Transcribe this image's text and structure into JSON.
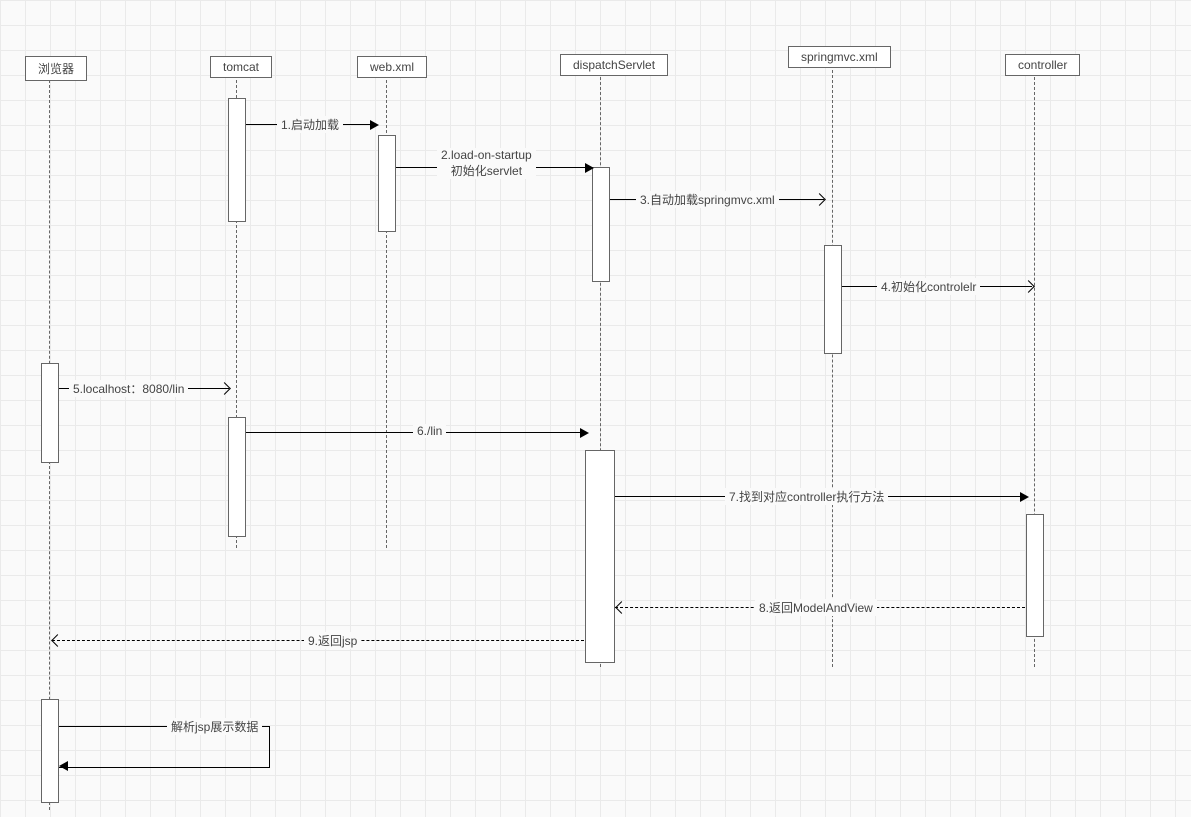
{
  "participants": {
    "browser": "浏览器",
    "tomcat": "tomcat",
    "webxml": "web.xml",
    "dispatch": "dispatchServlet",
    "springmvc": "springmvc.xml",
    "controller": "controller"
  },
  "messages": {
    "m1": "1.启动加载",
    "m2a": "2.load-on-startup",
    "m2b": "初始化servlet",
    "m3": "3.自动加载springmvc.xml",
    "m4": "4.初始化controlelr",
    "m5": "5.localhost：8080/lin",
    "m6": "6./lin",
    "m7": "7.找到对应controller执行方法",
    "m8": "8.返回ModelAndView",
    "m9": "9.返回jsp",
    "m10": "解析jsp展示数据"
  }
}
